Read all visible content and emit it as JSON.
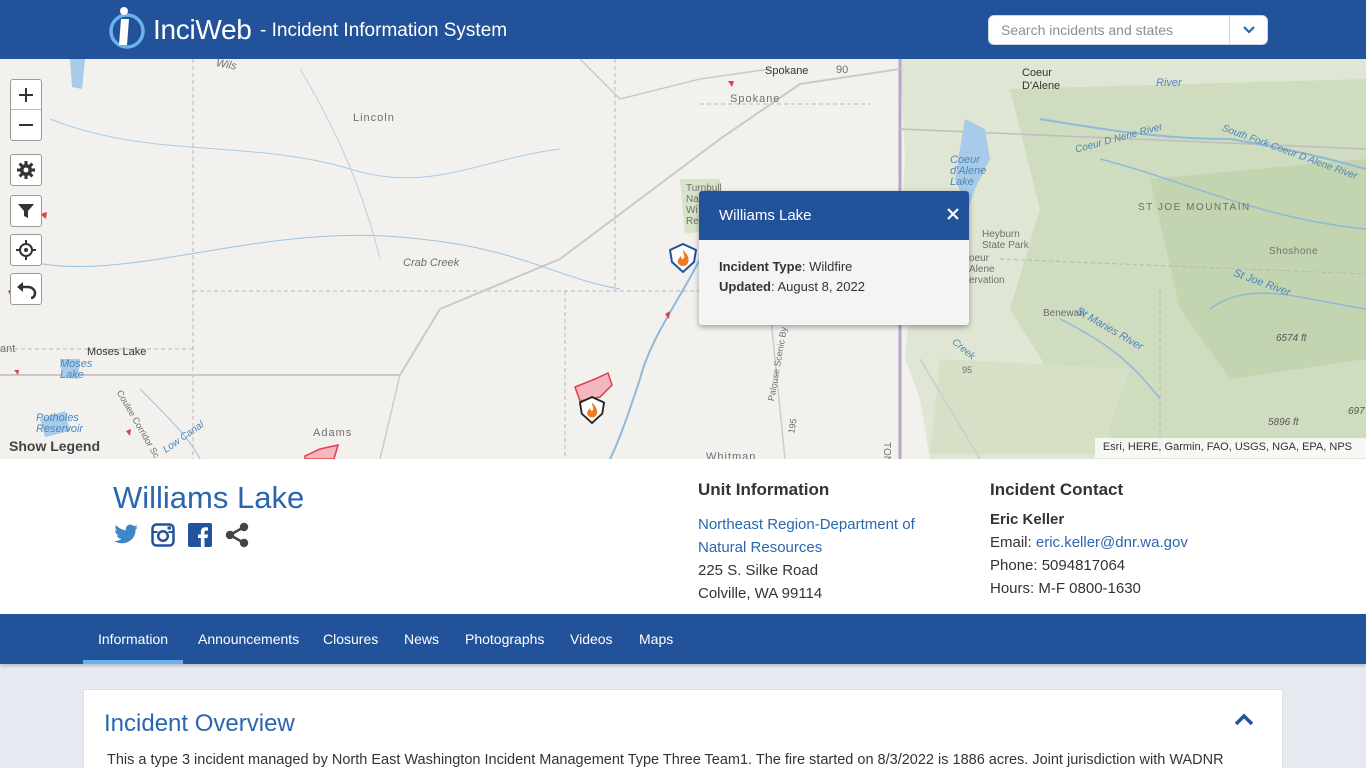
{
  "header": {
    "brand": "InciWeb",
    "tagline": "- Incident Information System",
    "search_placeholder": "Search incidents and states"
  },
  "map": {
    "labels": {
      "spokane_top": "Spokane",
      "spokane": "Spokane",
      "hwy90": "90",
      "coeur_dalene_city": "Coeur\nD'Alene",
      "lincoln": "Lincoln",
      "turnbull": "Turnbull\nNa\nWi\nRe",
      "crab_creek": "Crab Creek",
      "moses_lake_city": "Moses Lake",
      "moses_lake_water": "Moses\nLake",
      "potholes": "Potholes\nReservoir",
      "adams": "Adams",
      "whitman": "Whitman",
      "coeur_dalene_lake": "Coeur\nd'Alene\nLake",
      "heyburn": "Heyburn\nState Park",
      "coeur_alene_res": "oeur\nAlene\nervation",
      "st_joe_mountain": "ST JOE MOUNTAIN",
      "shoshone": "Shoshone",
      "st_joe_river": "St Joe River",
      "benewah": "Benewah",
      "st_maries_river": "St Maries River",
      "elev_6574": "6574 ft",
      "elev_5896": "5896 ft",
      "elev_697": "697",
      "coeur_d_nene_river": "Coeur D Nene River",
      "south_fork": "South Fork Coeur D Alene River",
      "palouse": "Palouse Scenic By",
      "ant": "ant",
      "wils": "Wils",
      "river": "River",
      "ton": "TON",
      "coulee": "Coulee Corridor Sc",
      "low_canal": "Low Canal",
      "creek": "Creek",
      "hwy95": "95",
      "hwy195": "195"
    },
    "show_legend": "Show Legend",
    "attribution": "Esri, HERE, Garmin, FAO, USGS, NGA, EPA, NPS"
  },
  "popup": {
    "title": "Williams Lake",
    "type_label": "Incident Type",
    "type_value": "Wildfire",
    "updated_label": "Updated",
    "updated_value": "August 8, 2022"
  },
  "incident": {
    "title": "Williams Lake"
  },
  "unit": {
    "heading": "Unit Information",
    "name_line1": "Northeast Region-Department of",
    "name_line2": "Natural Resources",
    "address": "225 S. Silke Road",
    "city": "Colville, WA 99114"
  },
  "contact": {
    "heading": "Incident Contact",
    "name": "Eric Keller",
    "email_label": "Email:",
    "email": "eric.keller@dnr.wa.gov",
    "phone": "Phone: 5094817064",
    "hours": "Hours: M-F 0800-1630"
  },
  "tabs": [
    {
      "label": "Information"
    },
    {
      "label": "Announcements"
    },
    {
      "label": "Closures"
    },
    {
      "label": "News"
    },
    {
      "label": "Photographs"
    },
    {
      "label": "Videos"
    },
    {
      "label": "Maps"
    }
  ],
  "overview": {
    "title": "Incident Overview",
    "text": "This a type 3 incident managed by North East Washington Incident Management Type Three Team1.  The fire started on 8/3/2022 is 1886 acres.  Joint jurisdiction with WADNR"
  },
  "colors": {
    "brand_blue": "#22539a",
    "link_blue": "#2a66b0",
    "tab_active": "#6ab3ee",
    "fire_red": "#e0404a"
  },
  "icons": {
    "zoom_in": "plus-icon",
    "zoom_out": "minus-icon",
    "settings": "gear-icon",
    "filter": "filter-icon",
    "locate": "crosshair-icon",
    "back": "undo-arrow-icon"
  }
}
